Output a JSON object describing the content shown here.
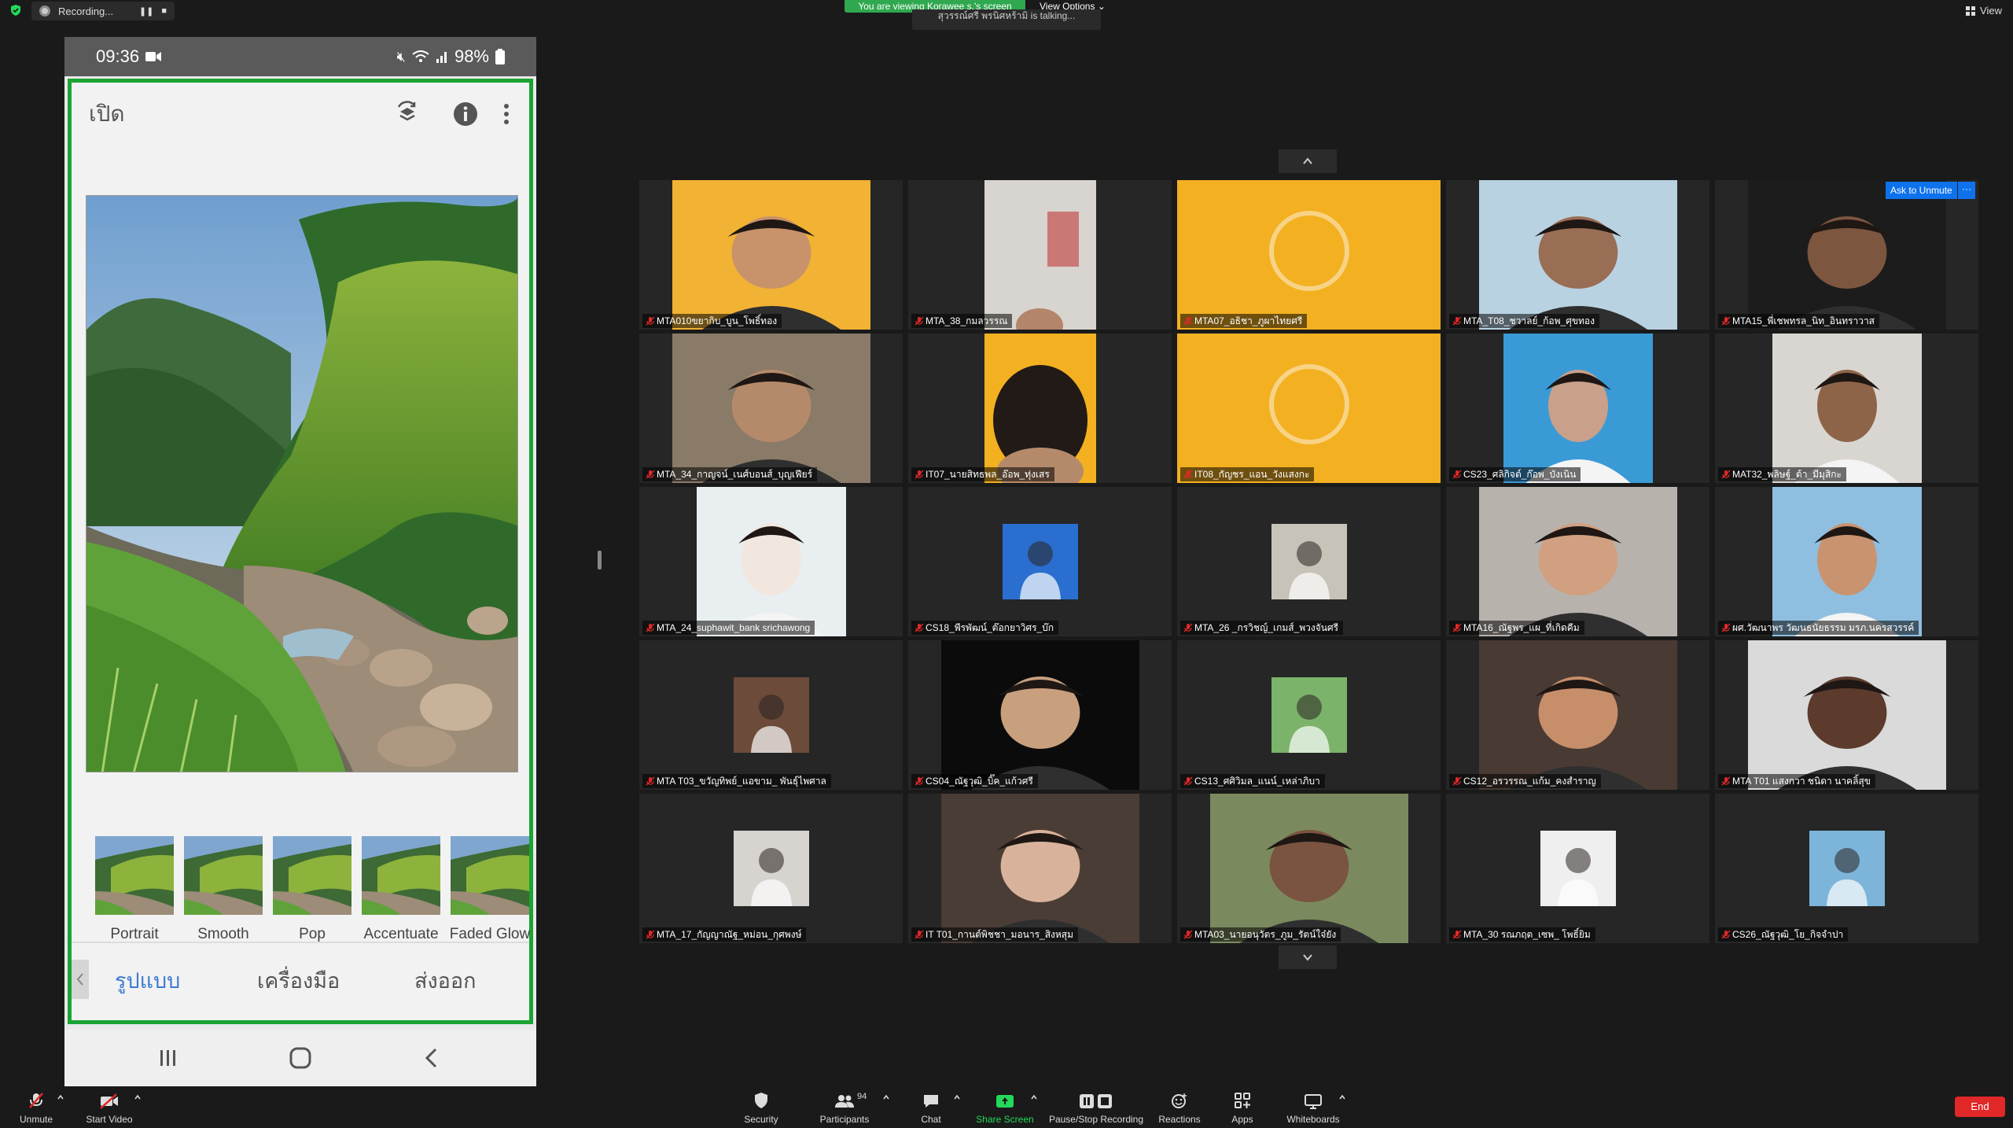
{
  "topbar": {
    "recording_label": "Recording...",
    "viewing_banner": "You are viewing Korawee s.'s screen",
    "view_options": "View Options",
    "talking": "สุวรรณ์ศรี พรนิศหร้ามิ is talking...",
    "view_label": "View"
  },
  "phone": {
    "time": "09:36",
    "battery": "98%",
    "app_title": "เปิด",
    "filters": [
      "Portrait",
      "Smooth",
      "Pop",
      "Accentuate",
      "Faded Glow"
    ],
    "tabs": [
      "รูปแบบ",
      "เครื่องมือ",
      "ส่งออก"
    ],
    "active_tab": 0
  },
  "gallery": {
    "ask_unmute": "Ask to Unmute",
    "ask_more": "···",
    "participants": [
      {
        "name": "MTA010ขยากิบ_บูน_โพธิ์ทอง",
        "tone": "#f2b233",
        "kind": "face",
        "skin": "#c8926a"
      },
      {
        "name": "MTA_38_กมลวรรณ",
        "tone": "#d8d4cf",
        "kind": "room",
        "skin": "#b3856a"
      },
      {
        "name": "MTA07_อธิชา_ภูผาไทยศรี",
        "tone": "#f3b021",
        "kind": "slide",
        "skin": "#3a2a22"
      },
      {
        "name": "MTA_T08_ชวาลย์_ก้อพ_ศุขทอง",
        "tone": "#b9d2e2",
        "kind": "face",
        "skin": "#9a6d55"
      },
      {
        "name": "MTA15_พี่เชพทรล_นิท_อินทราวาส",
        "tone": "#1c1c1c",
        "kind": "face",
        "skin": "#7d563f"
      },
      {
        "name": "MTA_34_กาญจน์_เนศ์บอนส์_บุญเฟียร์",
        "tone": "#8a7a68",
        "kind": "face",
        "skin": "#b58a6a"
      },
      {
        "name": "IT07_นายสิทธพล_อ๊อพ_ทุ่งเสร",
        "tone": "#f3b021",
        "kind": "hair",
        "skin": "#2c241f"
      },
      {
        "name": "IT08_กัญชร_แอน_วังแสงกะ",
        "tone": "#f3b021",
        "kind": "slide",
        "skin": "#f3b021"
      },
      {
        "name": "CS23_ศลิกิจต์_ก๊อพ_บังเนิน",
        "tone": "#3a9ad6",
        "kind": "id",
        "skin": "#c9a08a"
      },
      {
        "name": "MAT32_พลิษฐ์_ต้า_มีมุสิกะ",
        "tone": "#d9d6d2",
        "kind": "id",
        "skin": "#8e6448"
      },
      {
        "name": "MTA_24_suphawit_bank srichawong",
        "tone": "#e9eef0",
        "kind": "id",
        "skin": "#f1e7df"
      },
      {
        "name": "CS18_พีรพัฒน์_ต๊อกยาวิศร_บ๊ก",
        "tone": "#262626",
        "kind": "small-id",
        "skin": "#2a6fd0"
      },
      {
        "name": "MTA_26 _กรวิชญ์_เกมส์_พวงจันศรี",
        "tone": "#262626",
        "kind": "small-id",
        "skin": "#c8c3b8"
      },
      {
        "name": "MTA16_ณัฐพร_แผ_ที่เกิดคีม",
        "tone": "#b8b2ad",
        "kind": "face",
        "skin": "#d0a080"
      },
      {
        "name": "ผศ.วัฒนาพร วัฒนธนัยธรรม มรภ.นครสวรรค์",
        "tone": "#8ebfe0",
        "kind": "id",
        "skin": "#c99370"
      },
      {
        "name": "MTA T03_ขวัญทิพย์_แอขาม_ พันธุ์ไพศาล",
        "tone": "#262626",
        "kind": "small-id",
        "skin": "#6c4b3a"
      },
      {
        "name": "CS04_ณัฐวุฒิ_บิ๊ค_แก้วศรี",
        "tone": "#0b0b0b",
        "kind": "face",
        "skin": "#c9a07e"
      },
      {
        "name": "CS13_ศศิวิมล_แนน์_เหล่าภิบา",
        "tone": "#262626",
        "kind": "small-id",
        "skin": "#7bb36a"
      },
      {
        "name": "CS12_อรวรรณ_แก้ม_คงสำราญ",
        "tone": "#4a3a34",
        "kind": "face",
        "skin": "#c78e6a"
      },
      {
        "name": "MTA T01 แสงกวา ชนิดา นาคลิ้สุข",
        "tone": "#dadada",
        "kind": "face",
        "skin": "#5c3b2c"
      },
      {
        "name": "MTA_17_กัญญาณัฐ_หม่อน_กุศพงษ์",
        "tone": "#262626",
        "kind": "small-id",
        "skin": "#d7d3cf"
      },
      {
        "name": "IT T01_กานต์พิชชา_มอนาร_สิงหสุม",
        "tone": "#4a3d36",
        "kind": "face",
        "skin": "#d8b29a"
      },
      {
        "name": "MTA03_นายอนุวัตร_ภูม_รัตน์ใจ๋ยัง",
        "tone": "#7b8a5e",
        "kind": "face",
        "skin": "#7a5440"
      },
      {
        "name": "MTA_30 รณภฤต_เซพ_ โพธิ์ยิม",
        "tone": "#262626",
        "kind": "small-id",
        "skin": "#efefef"
      },
      {
        "name": "CS26_ณัฐวุฒิ_โย_กิจจำปา",
        "tone": "#262626",
        "kind": "small-id",
        "skin": "#7cb5d9"
      }
    ]
  },
  "toolbar": {
    "unmute": "Unmute",
    "start_video": "Start Video",
    "security": "Security",
    "participants": "Participants",
    "participants_count": "94",
    "chat": "Chat",
    "share_screen": "Share Screen",
    "pause_recording": "Pause/Stop Recording",
    "reactions": "Reactions",
    "apps": "Apps",
    "whiteboards": "Whiteboards",
    "end": "End"
  },
  "colors": {
    "accent_green": "#1aa431",
    "zoom_blue": "#0e72ed",
    "end_red": "#e02828",
    "share_green": "#23d959"
  }
}
